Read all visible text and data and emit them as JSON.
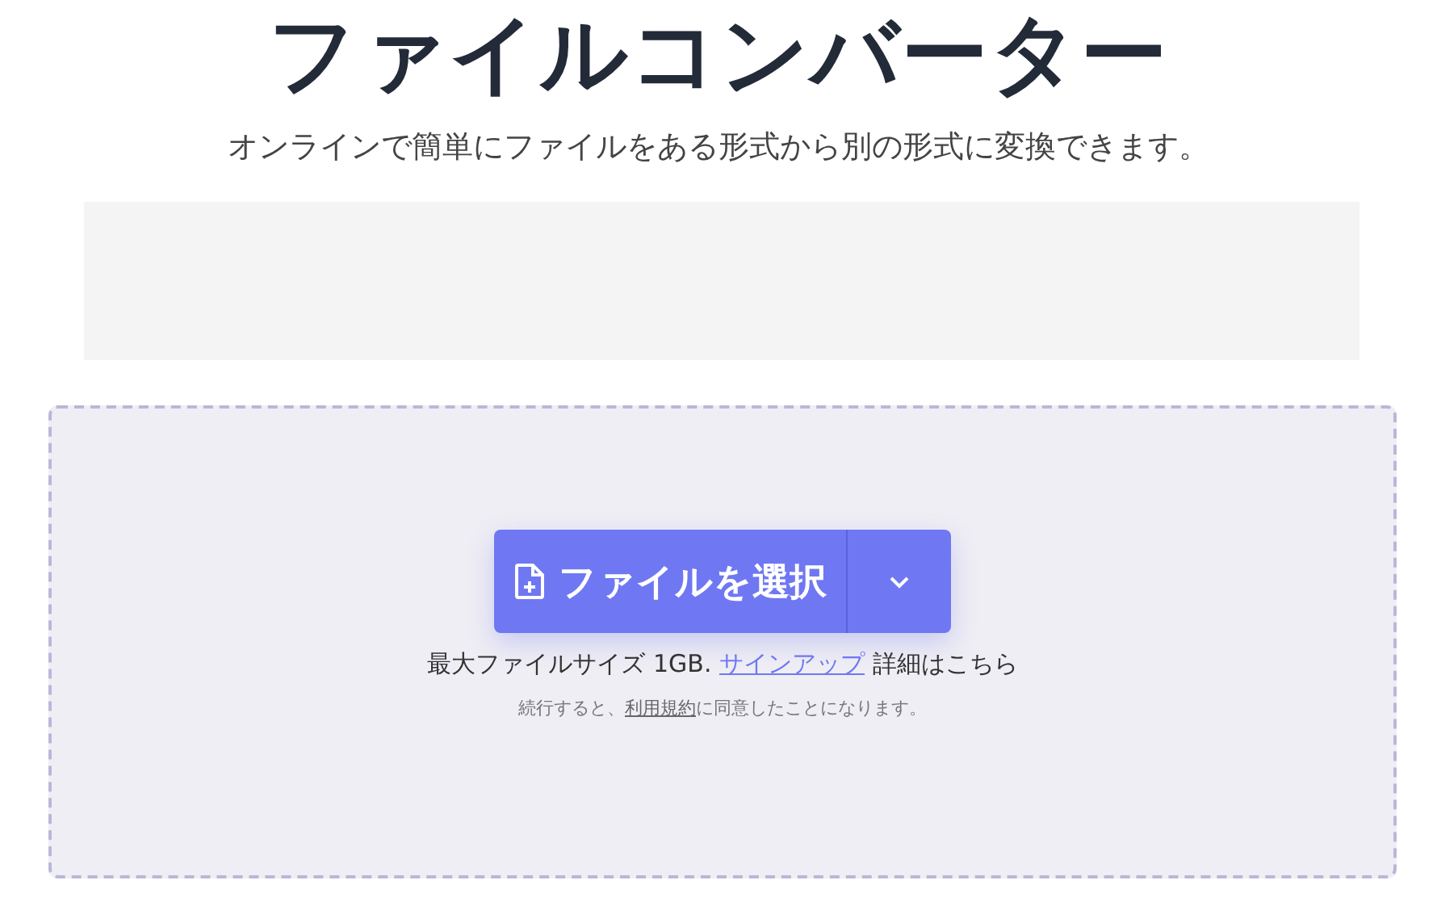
{
  "header": {
    "title": "ファイルコンバーター",
    "subtitle": "オンラインで簡単にファイルをある形式から別の形式に変換できます。"
  },
  "upload": {
    "button": {
      "label": "ファイルを選択"
    },
    "info": {
      "before": "最大ファイルサイズ 1GB.",
      "link": "サインアップ",
      "after": "詳細はこちら"
    },
    "terms": {
      "before": "続行すると、",
      "link": "利用規約",
      "after": "に同意したことになります。"
    }
  }
}
